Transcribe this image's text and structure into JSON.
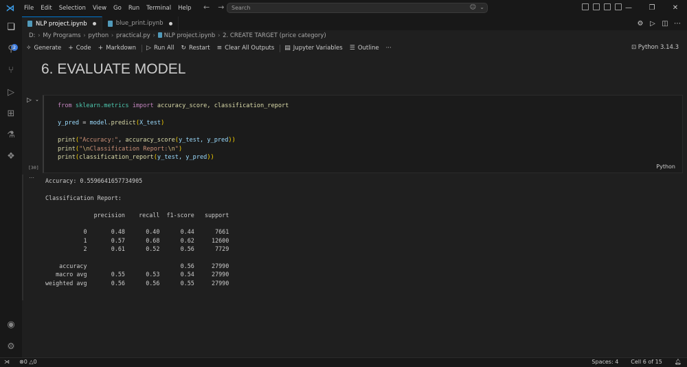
{
  "titlebar": {
    "menu": [
      "File",
      "Edit",
      "Selection",
      "View",
      "Go",
      "Run",
      "Terminal",
      "Help"
    ],
    "search_placeholder": "Search"
  },
  "activity": {
    "badge_count": "2"
  },
  "tabs": [
    {
      "label": "NLP project.ipynb",
      "active": true
    },
    {
      "label": "blue_print.ipynb",
      "active": false
    }
  ],
  "breadcrumb": {
    "parts": [
      "D:",
      "My Programs",
      "python",
      "practical.py",
      "NLP project.ipynb",
      "2. CREATE TARGET (price category)"
    ]
  },
  "toolbar": {
    "generate": "Generate",
    "code": "Code",
    "markdown": "Markdown",
    "run_all": "Run All",
    "restart": "Restart",
    "clear_outputs": "Clear All Outputs",
    "variables": "Jupyter Variables",
    "outline": "Outline",
    "more": "···",
    "kernel": "Python 3.14.3"
  },
  "markdown_heading": "6. EVALUATE MODEL",
  "cell": {
    "execution_count": "[30]",
    "language": "Python",
    "code": {
      "l1_kw1": "from",
      "l1_mod": "sklearn.metrics",
      "l1_kw2": "import",
      "l1_names": "accuracy_score, classification_report",
      "l3_var": "y_pred",
      "l3_eq": " = ",
      "l3_obj": "model",
      "l3_fn": ".predict",
      "l3_arg": "X_test",
      "l5_fn": "print",
      "l5_str": "\"Accuracy:\"",
      "l5_fn2": "accuracy_score",
      "l5_args": "y_test, y_pred",
      "l6_fn": "print",
      "l6_str1": "\"",
      "l6_esc": "\\n",
      "l6_str2": "Classification Report:",
      "l6_str3": "\"",
      "l7_fn": "print",
      "l7_fn2": "classification_report",
      "l7_args": "y_test, y_pred"
    }
  },
  "output": {
    "accuracy_line": "Accuracy: 0.5596641657734905",
    "report_title": "Classification Report:",
    "header": "              precision    recall  f1-score   support",
    "rows": [
      "           0       0.48      0.40      0.44      7661",
      "           1       0.57      0.68      0.62     12600",
      "           2       0.61      0.52      0.56      7729"
    ],
    "summary": [
      "    accuracy                           0.56     27990",
      "   macro avg       0.55      0.53      0.54     27990",
      "weighted avg       0.56      0.56      0.55     27990"
    ]
  },
  "statusbar": {
    "errors": "0",
    "warnings": "0",
    "spaces": "Spaces: 4",
    "cell_pos": "Cell 6 of 15"
  }
}
